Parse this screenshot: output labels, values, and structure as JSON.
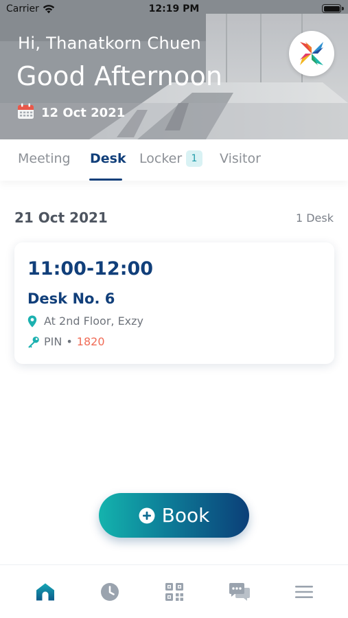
{
  "status_bar": {
    "carrier": "Carrier",
    "time": "12:19 PM"
  },
  "header": {
    "greeting": "Hi, Thanatkorn Chuen",
    "headline": "Good Afternoon",
    "date": "12 Oct 2021"
  },
  "tabs": [
    {
      "label": "Meeting",
      "active": false
    },
    {
      "label": "Desk",
      "active": true
    },
    {
      "label": "Locker",
      "active": false,
      "badge": "1"
    },
    {
      "label": "Visitor",
      "active": false
    }
  ],
  "section": {
    "date": "21 Oct 2021",
    "count": "1 Desk"
  },
  "bookings": [
    {
      "time": "11:00-12:00",
      "desk": "Desk No. 6",
      "location": "At 2nd Floor, Exzy",
      "pin_label": "PIN",
      "pin_separator": "•",
      "pin_value": "1820"
    }
  ],
  "book_button": {
    "label": "Book",
    "icon": "plus-circle-icon"
  },
  "bottom_nav": [
    {
      "icon": "home-icon",
      "active": true
    },
    {
      "icon": "clock-icon",
      "active": false
    },
    {
      "icon": "qr-code-icon",
      "active": false
    },
    {
      "icon": "chat-icon",
      "active": false
    },
    {
      "icon": "menu-icon",
      "active": false
    }
  ],
  "colors": {
    "primary": "#113f7a",
    "accent_teal": "#14b3ad",
    "pin_value": "#f06b56",
    "inactive": "#8c9096"
  }
}
